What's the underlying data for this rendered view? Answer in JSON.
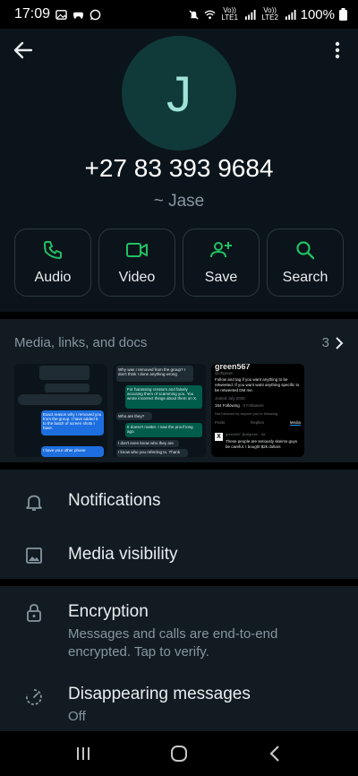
{
  "status_bar": {
    "time": "17:09",
    "sim1_label": "Vo)) LTE1",
    "sim2_label": "Vo)) LTE2",
    "battery": "100%"
  },
  "profile": {
    "avatar_initial": "J",
    "phone": "+27 83 393 9684",
    "nickname": "~ Jase"
  },
  "actions": [
    {
      "label": "Audio",
      "icon": "phone-icon"
    },
    {
      "label": "Video",
      "icon": "video-icon"
    },
    {
      "label": "Save",
      "icon": "add-contact-icon"
    },
    {
      "label": "Search",
      "icon": "search-icon"
    }
  ],
  "media": {
    "title": "Media, links, and docs",
    "count": "3"
  },
  "settings": {
    "notifications": "Notifications",
    "media_visibility": "Media visibility",
    "encryption_title": "Encryption",
    "encryption_sub": "Messages and calls are end-to-end encrypted. Tap to verify.",
    "disappearing_title": "Disappearing messages",
    "disappearing_sub": "Off"
  },
  "thumb2": {
    "msg1": "Why was I removed from the group? I don't think I done anything wrong",
    "msg2": "For harassing creators and falsely accusing them of scamming you. You wrote incorrect things about them on X.",
    "msg3": "Who are they?",
    "msg4": "It doesn't matter. I saw the proof long ago.",
    "msg5": "I don't even know who they are",
    "msg6": "I know who you referring to. Thank"
  },
  "thumb1": {
    "msg1": "Exact reason why I removed you from the group. I have added it to the batch of screen shots I have.",
    "msg2": "I have your other phone"
  },
  "thumb3": {
    "name": "green567",
    "handle": "@cflgreen",
    "bio": "Follow and tag if you want anything to be retweeted. If you want want anything specific to be retweeted DM me.",
    "joined": "Joined July 2025",
    "following": "154 Following",
    "followers": "0 Followers",
    "note": "Not followed by anyone you're following",
    "tabs": [
      "Posts",
      "Replies",
      "Media"
    ],
    "post_user": "green567 @cflgreen · 5d",
    "post_text": "These people are seriously skeims guys be careful. I bought $2k dollars"
  },
  "colors": {
    "accent": "#21c063",
    "background": "#0b141a",
    "surface": "#111b21",
    "muted": "#8696a0"
  }
}
